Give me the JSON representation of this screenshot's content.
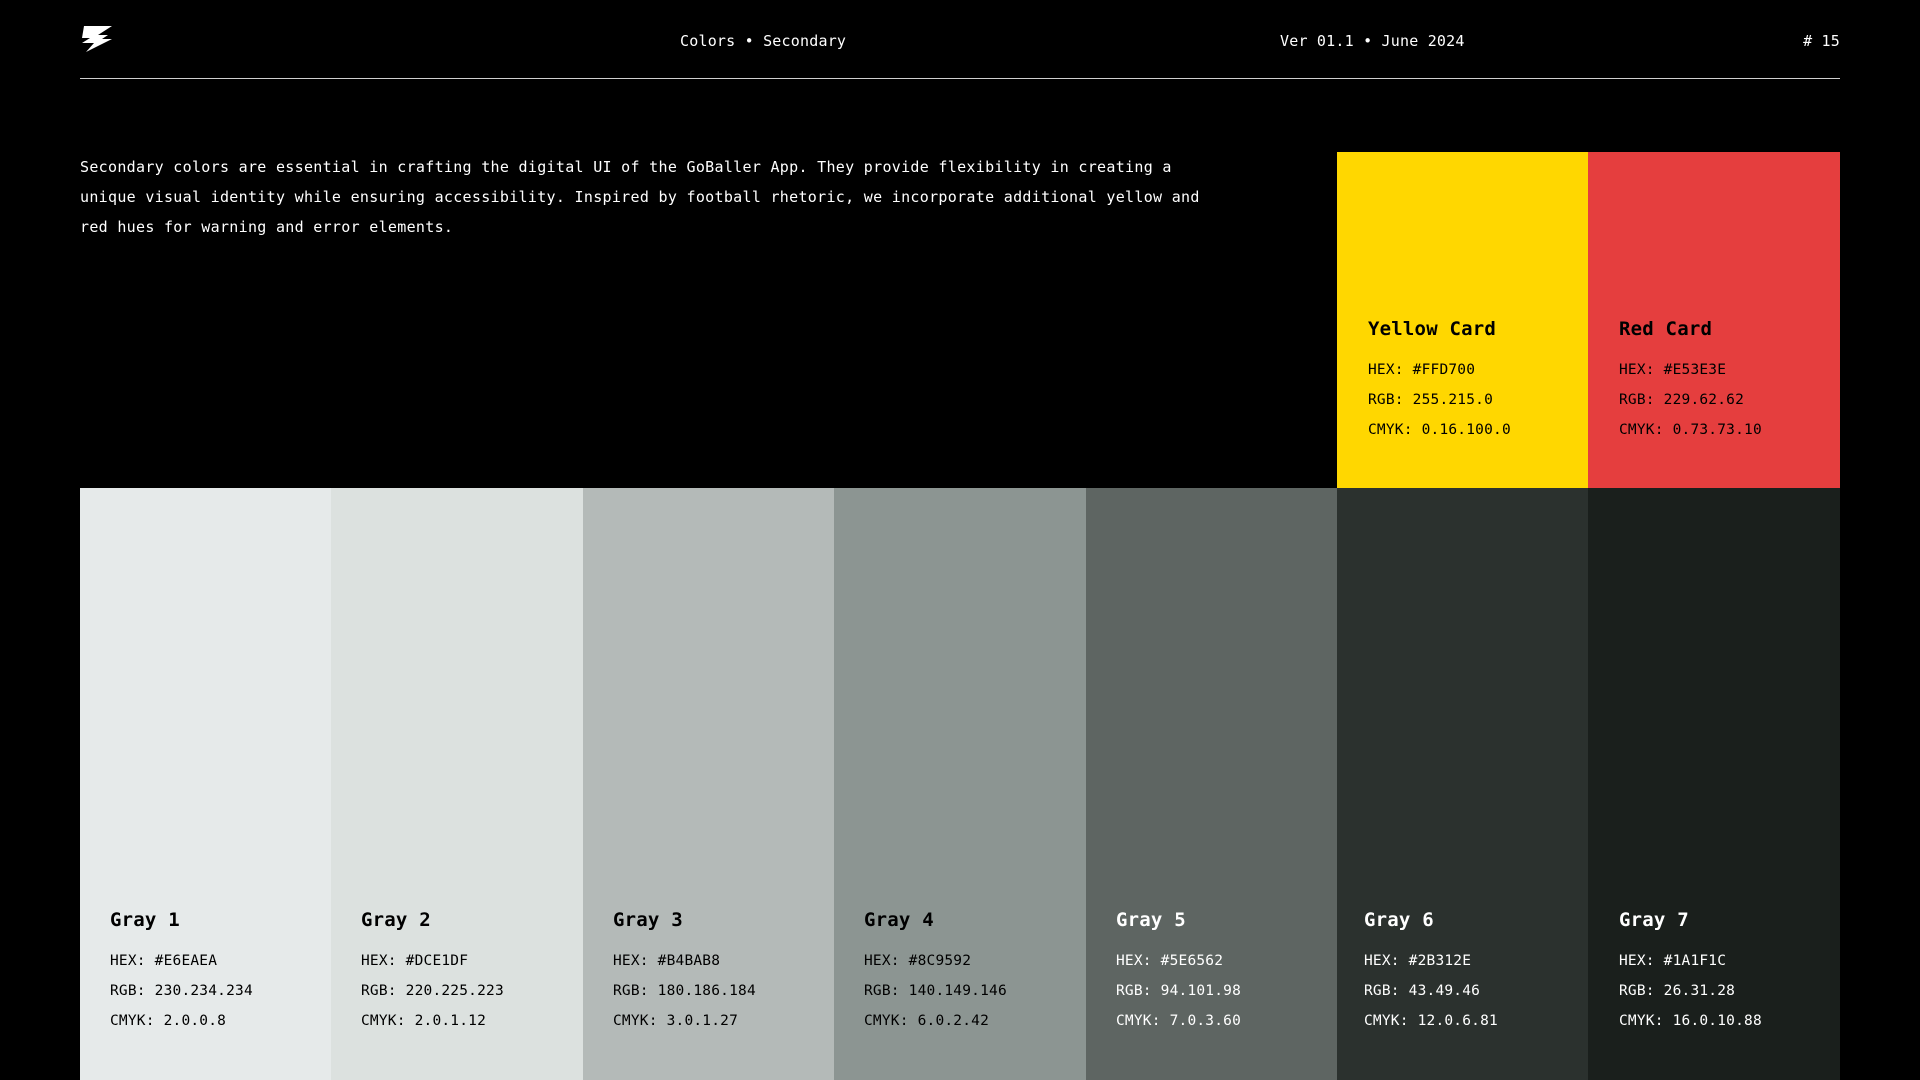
{
  "header": {
    "section": "Colors • Secondary",
    "version": "Ver 01.1 • June 2024",
    "page": "# 15",
    "logo_icon": "goballer-logo-icon"
  },
  "intro": {
    "text": "Secondary colors are essential in crafting the digital UI of the GoBaller App. They provide flexibility in creating a unique visual identity while ensuring accessibility. Inspired by football rhetoric, we incorporate additional yellow and red hues for warning and error elements."
  },
  "accents": [
    {
      "name": "Yellow Card",
      "hex": "HEX: #FFD700",
      "rgb": "RGB: 255.215.0",
      "cmyk": "CMYK: 0.16.100.0",
      "color": "#FFD700",
      "text_color": "#000000"
    },
    {
      "name": "Red Card",
      "hex": "HEX: #E53E3E",
      "rgb": "RGB: 229.62.62",
      "cmyk": "CMYK: 0.73.73.10",
      "color": "#E53E3E",
      "text_color": "#000000"
    }
  ],
  "grays": [
    {
      "name": "Gray 1",
      "hex": "HEX: #E6EAEA",
      "rgb": "RGB: 230.234.234",
      "cmyk": "CMYK: 2.0.0.8",
      "color": "#E6EAEA",
      "text_color": "#000000"
    },
    {
      "name": "Gray 2",
      "hex": "HEX: #DCE1DF",
      "rgb": "RGB: 220.225.223",
      "cmyk": "CMYK: 2.0.1.12",
      "color": "#DCE1DF",
      "text_color": "#000000"
    },
    {
      "name": "Gray 3",
      "hex": "HEX: #B4BAB8",
      "rgb": "RGB: 180.186.184",
      "cmyk": "CMYK: 3.0.1.27",
      "color": "#B4BAB8",
      "text_color": "#000000"
    },
    {
      "name": "Gray 4",
      "hex": "HEX: #8C9592",
      "rgb": "RGB: 140.149.146",
      "cmyk": "CMYK: 6.0.2.42",
      "color": "#8C9592",
      "text_color": "#000000"
    },
    {
      "name": "Gray 5",
      "hex": "HEX: #5E6562",
      "rgb": "RGB: 94.101.98",
      "cmyk": "CMYK: 7.0.3.60",
      "color": "#5E6562",
      "text_color": "#FFFFFF"
    },
    {
      "name": "Gray 6",
      "hex": "HEX: #2B312E",
      "rgb": "RGB: 43.49.46",
      "cmyk": "CMYK: 12.0.6.81",
      "color": "#2B312E",
      "text_color": "#FFFFFF"
    },
    {
      "name": "Gray 7",
      "hex": "HEX: #1A1F1C",
      "rgb": "RGB: 26.31.28",
      "cmyk": "CMYK: 16.0.10.88",
      "color": "#1A1F1C",
      "text_color": "#FFFFFF"
    }
  ]
}
